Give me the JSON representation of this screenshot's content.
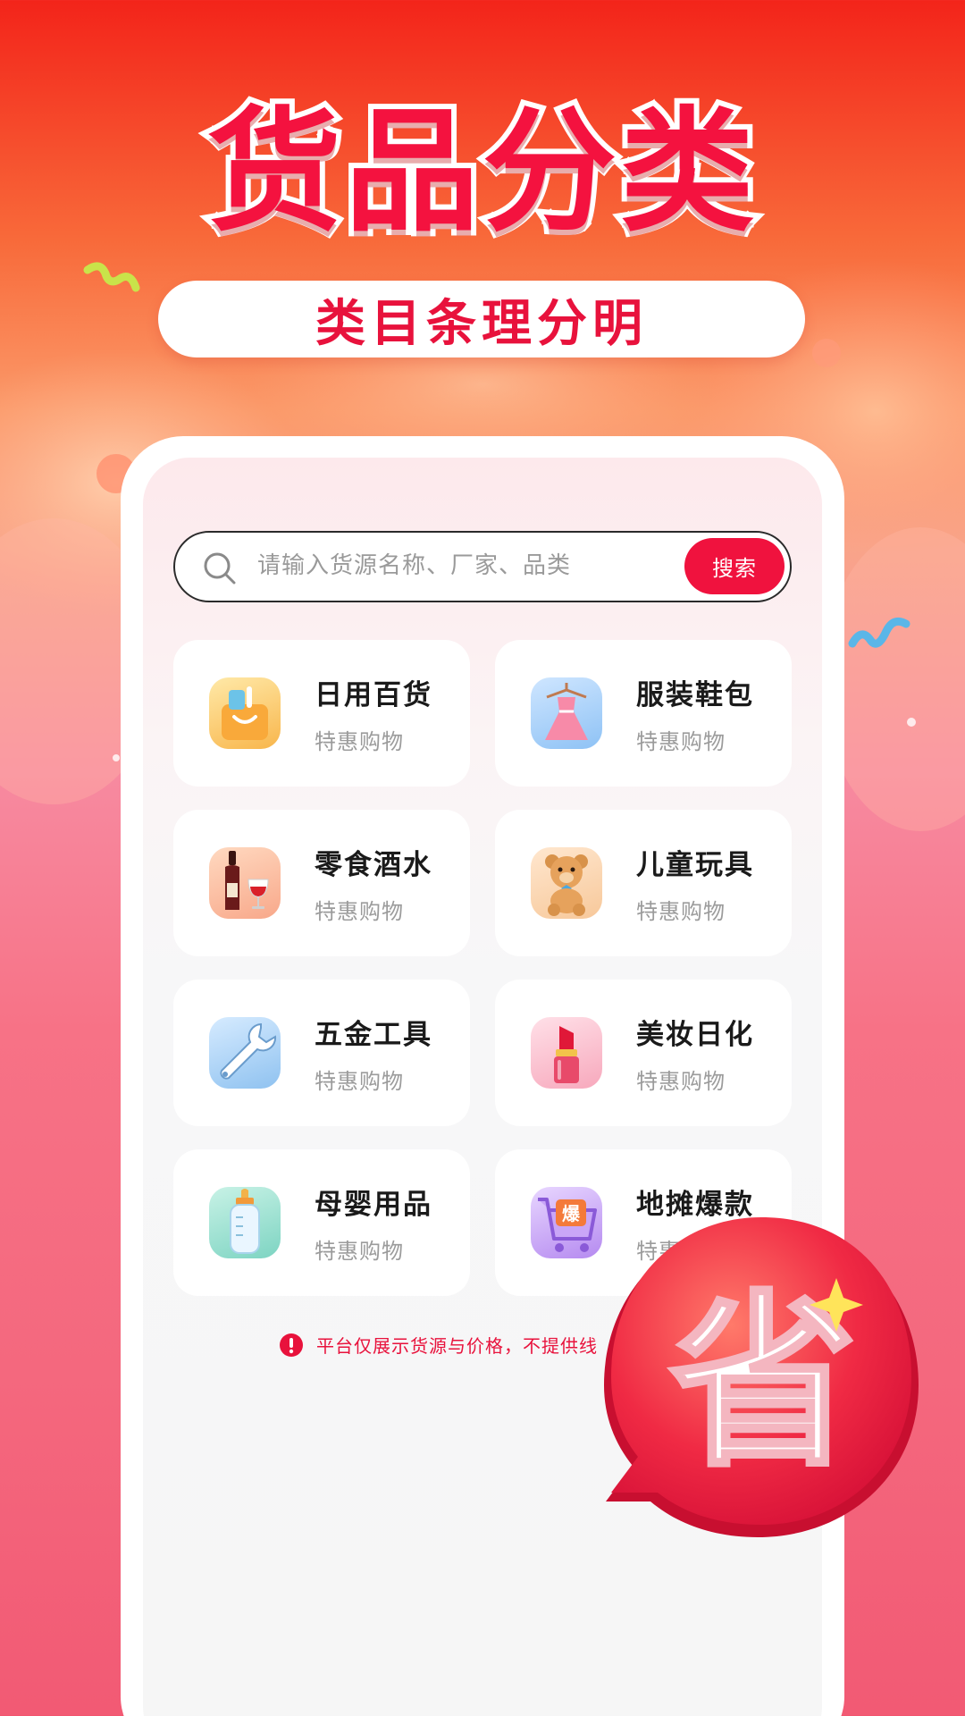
{
  "hero": {
    "title": "货品分类",
    "subtitle": "类目条理分明"
  },
  "search": {
    "placeholder": "请输入货源名称、厂家、品类",
    "button_label": "搜索"
  },
  "categories": [
    {
      "name": "日用百货",
      "sub": "特惠购物",
      "icon": "shopping-bag-icon"
    },
    {
      "name": "服装鞋包",
      "sub": "特惠购物",
      "icon": "dress-icon"
    },
    {
      "name": "零食酒水",
      "sub": "特惠购物",
      "icon": "wine-icon"
    },
    {
      "name": "儿童玩具",
      "sub": "特惠购物",
      "icon": "teddy-bear-icon"
    },
    {
      "name": "五金工具",
      "sub": "特惠购物",
      "icon": "wrench-icon"
    },
    {
      "name": "美妆日化",
      "sub": "特惠购物",
      "icon": "lipstick-icon"
    },
    {
      "name": "母婴用品",
      "sub": "特惠购物",
      "icon": "baby-bottle-icon"
    },
    {
      "name": "地摊爆款",
      "sub": "特惠购物",
      "icon": "cart-icon",
      "badge": "爆"
    }
  ],
  "notice": {
    "text": "平台仅展示货源与价格，不提供线"
  },
  "badge": {
    "text": "省"
  },
  "colors": {
    "brand_red": "#f0123e",
    "title_red": "#f4123f"
  }
}
